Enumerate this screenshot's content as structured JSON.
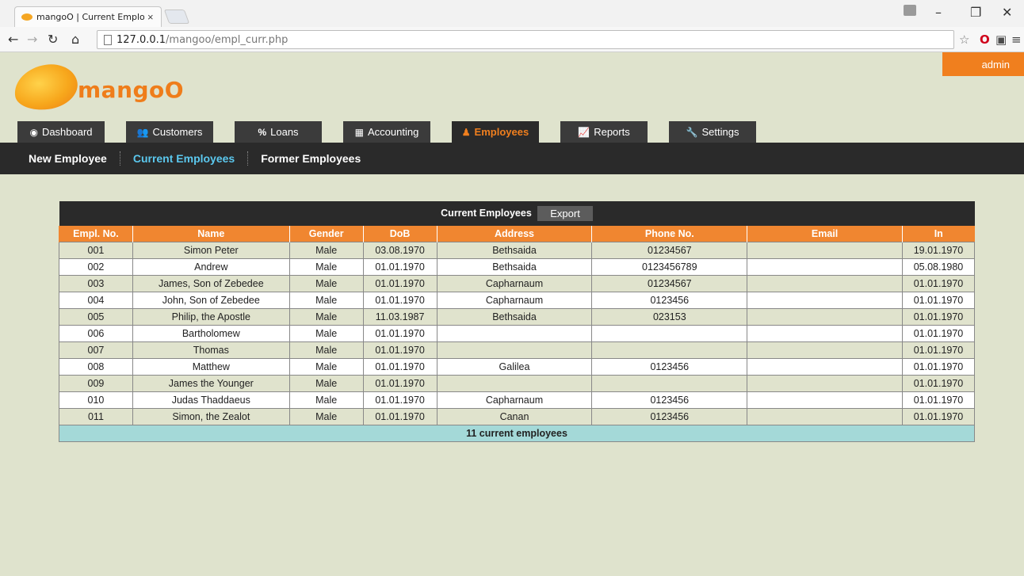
{
  "browser": {
    "tab_title": "mangoO | Current Employ",
    "tab_close": "×",
    "url_host": "127.0.0.1",
    "url_path": "/mangoo/empl_curr.php"
  },
  "header": {
    "user_label": "admin",
    "logo_text": "mangoO",
    "accent_color": "#f07f1e"
  },
  "nav": {
    "tabs": [
      {
        "label": "Dashboard",
        "icon": "dashboard-icon"
      },
      {
        "label": "Customers",
        "icon": "users-icon"
      },
      {
        "label": "Loans",
        "icon": "percent-icon"
      },
      {
        "label": "Accounting",
        "icon": "calculator-icon"
      },
      {
        "label": "Employees",
        "icon": "person-icon",
        "active": true
      },
      {
        "label": "Reports",
        "icon": "chart-icon"
      },
      {
        "label": "Settings",
        "icon": "wrench-icon"
      }
    ],
    "subitems": [
      {
        "label": "New Employee"
      },
      {
        "label": "Current Employees",
        "active": true
      },
      {
        "label": "Former Employees"
      }
    ]
  },
  "table": {
    "title": "Current Employees",
    "export_label": "Export",
    "columns": [
      "Empl. No.",
      "Name",
      "Gender",
      "DoB",
      "Address",
      "Phone No.",
      "Email",
      "In"
    ],
    "rows": [
      [
        "001",
        "Simon Peter",
        "Male",
        "03.08.1970",
        "Bethsaida",
        "01234567",
        "",
        "19.01.1970"
      ],
      [
        "002",
        "Andrew",
        "Male",
        "01.01.1970",
        "Bethsaida",
        "0123456789",
        "",
        "05.08.1980"
      ],
      [
        "003",
        "James, Son of Zebedee",
        "Male",
        "01.01.1970",
        "Capharnaum",
        "01234567",
        "",
        "01.01.1970"
      ],
      [
        "004",
        "John, Son of Zebedee",
        "Male",
        "01.01.1970",
        "Capharnaum",
        "0123456",
        "",
        "01.01.1970"
      ],
      [
        "005",
        "Philip, the Apostle",
        "Male",
        "11.03.1987",
        "Bethsaida",
        "023153",
        "",
        "01.01.1970"
      ],
      [
        "006",
        "Bartholomew",
        "Male",
        "01.01.1970",
        "",
        "",
        "",
        "01.01.1970"
      ],
      [
        "007",
        "Thomas",
        "Male",
        "01.01.1970",
        "",
        "",
        "",
        "01.01.1970"
      ],
      [
        "008",
        "Matthew",
        "Male",
        "01.01.1970",
        "Galilea",
        "0123456",
        "",
        "01.01.1970"
      ],
      [
        "009",
        "James the Younger",
        "Male",
        "01.01.1970",
        "",
        "",
        "",
        "01.01.1970"
      ],
      [
        "010",
        "Judas Thaddaeus",
        "Male",
        "01.01.1970",
        "Capharnaum",
        "0123456",
        "",
        "01.01.1970"
      ],
      [
        "011",
        "Simon, the Zealot",
        "Male",
        "01.01.1970",
        "Canan",
        "0123456",
        "",
        "01.01.1970"
      ]
    ],
    "footer": "11 current employees"
  }
}
